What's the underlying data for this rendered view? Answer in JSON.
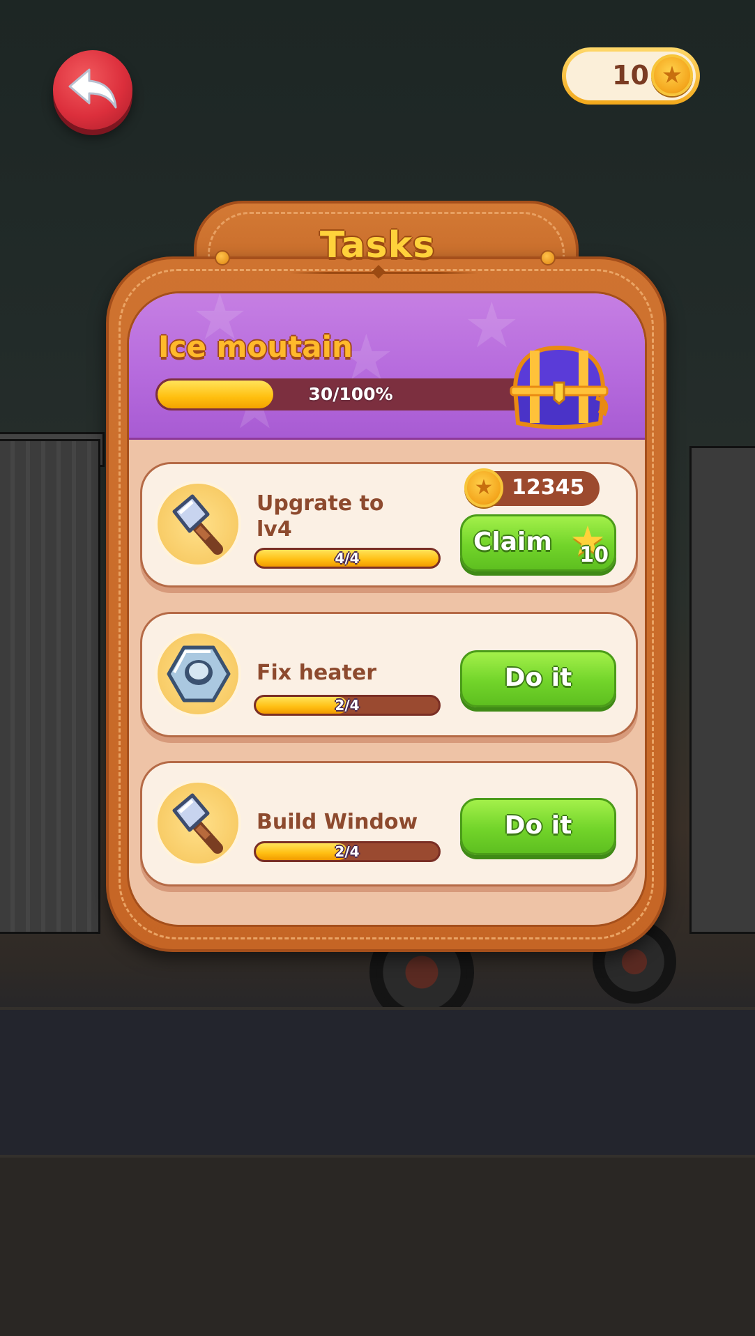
{
  "header": {
    "coin_count": "10"
  },
  "panel": {
    "title": "Tasks",
    "banner": {
      "title": "Ice moutain",
      "progress_label": "30/100%",
      "progress_fraction": 0.3
    },
    "tasks": [
      {
        "title": "Upgrate to lv4",
        "progress_label": "4/4",
        "progress_fraction": 1.0,
        "icon": "hammer-icon",
        "reward_coins": "12345",
        "button_label": "Claim",
        "button_star_value": "10"
      },
      {
        "title": "Fix heater",
        "progress_label": "2/4",
        "progress_fraction": 0.5,
        "icon": "hex-nut-icon",
        "button_label": "Do it"
      },
      {
        "title": "Build Window",
        "progress_label": "2/4",
        "progress_fraction": 0.5,
        "icon": "hammer-icon",
        "button_label": "Do it"
      }
    ]
  },
  "colors": {
    "panel_brown": "#c96b29",
    "banner_purple": "#b66bdd",
    "button_green": "#72d42a",
    "title_yellow": "#ffd23b",
    "text_brown": "#8d4a2e"
  }
}
